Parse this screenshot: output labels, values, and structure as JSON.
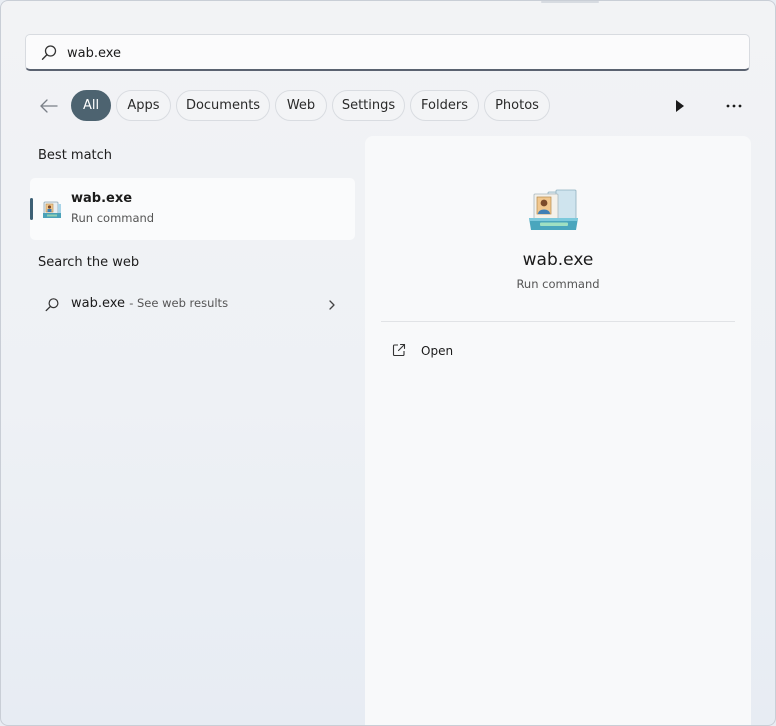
{
  "search": {
    "value": "wab.exe",
    "icon": "search-icon"
  },
  "filters": {
    "back_icon": "back-arrow-icon",
    "chips": [
      {
        "label": "All",
        "active": true
      },
      {
        "label": "Apps",
        "active": false
      },
      {
        "label": "Documents",
        "active": false
      },
      {
        "label": "Web",
        "active": false
      },
      {
        "label": "Settings",
        "active": false
      },
      {
        "label": "Folders",
        "active": false
      },
      {
        "label": "Photos",
        "active": false
      }
    ],
    "play_icon": "play-icon",
    "more_icon": "more-icon"
  },
  "best_match": {
    "heading": "Best match",
    "item": {
      "name": "wab.exe",
      "type": "Run command",
      "icon": "address-book-icon"
    }
  },
  "web_search": {
    "heading": "Search the web",
    "query": "wab.exe",
    "suffix": "- See web results",
    "icon": "search-icon",
    "chevron": "chevron-right-icon"
  },
  "details": {
    "title": "wab.exe",
    "subtitle": "Run command",
    "icon": "address-book-icon",
    "actions": [
      {
        "label": "Open",
        "icon": "open-external-icon"
      }
    ]
  },
  "colors": {
    "active_chip": "#4d6370",
    "accent": "#3d6075"
  }
}
